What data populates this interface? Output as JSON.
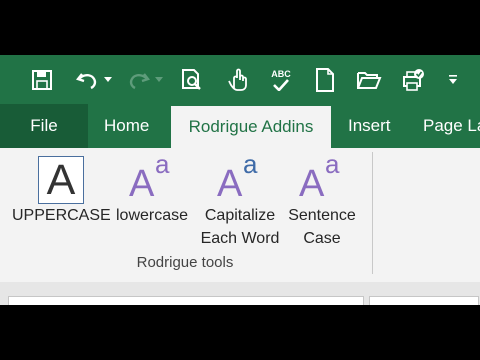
{
  "colors": {
    "brand_green": "#217346",
    "file_green": "#185c37",
    "ribbon_bg": "#f3f3f3",
    "purple": "#8a6cc0",
    "blue": "#3f6ba8"
  },
  "qat": {
    "icons": [
      "save-icon",
      "undo-icon",
      "undo-dropdown-icon",
      "redo-icon",
      "redo-dropdown-icon",
      "print-preview-icon",
      "touch-mode-icon",
      "spelling-icon",
      "new-file-icon",
      "open-folder-icon",
      "share-icon",
      "customize-qat-icon"
    ],
    "spelling_abc": "ABC"
  },
  "tabs": {
    "file": "File",
    "home": "Home",
    "active": "Rodrigue Addins",
    "insert": "Insert",
    "page_layout_partial": "Page La"
  },
  "ribbon": {
    "group_label": "Rodrigue tools",
    "buttons": {
      "uppercase": {
        "glyph": "A",
        "label": "UPPERCASE"
      },
      "lowercase": {
        "glyph_big": "A",
        "glyph_small": "a",
        "label": "lowercase"
      },
      "capitalize": {
        "glyph_big": "A",
        "glyph_small": "a",
        "label_line1": "Capitalize",
        "label_line2": "Each Word"
      },
      "sentence": {
        "glyph_big": "A",
        "glyph_small": "a",
        "label_line1": "Sentence",
        "label_line2": "Case"
      }
    }
  }
}
